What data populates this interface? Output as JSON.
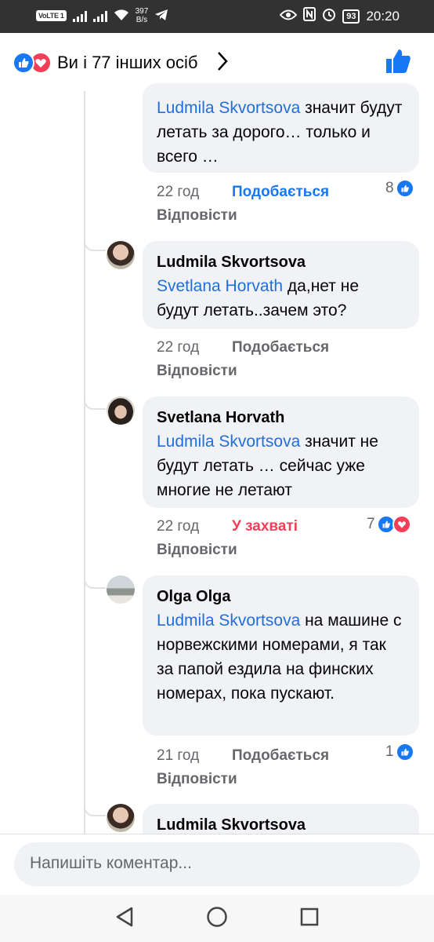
{
  "status_bar": {
    "volte": "VoLTE 1",
    "speed_top": "397",
    "speed_bottom": "B/s",
    "battery": "93",
    "time": "20:20"
  },
  "header": {
    "reaction_summary": "Ви і 77 інших осіб"
  },
  "comments": [
    {
      "author": "",
      "mention": "Ludmila Skvortsova",
      "text": "  значит будут летать за дорого… только и всего …",
      "time": "22 год",
      "like_label": "Подобається",
      "like_state": "liked",
      "reply_label": "Відповісти",
      "reaction_count": "8"
    },
    {
      "author": "Ludmila Skvortsova",
      "mention": "Svetlana Horvath",
      "text": " да,нет не будут летать..зачем это?",
      "time": "22 год",
      "like_label": "Подобається",
      "like_state": "none",
      "reply_label": "Відповісти",
      "reaction_count": ""
    },
    {
      "author": "Svetlana Horvath",
      "mention": "Ludmila Skvortsova",
      "text": "  значит не будут летать … сейчас уже многие не летают",
      "time": "22 год",
      "like_label": "У захваті",
      "like_state": "love",
      "reply_label": "Відповісти",
      "reaction_count": "7"
    },
    {
      "author": "Olga Olga",
      "mention": "Ludmila Skvortsova",
      "text": " на машине с норвежскими номерами, я так за папой ездила на финских номерах, пока пускают.",
      "time": "21 год",
      "like_label": "Подобається",
      "like_state": "none",
      "reply_label": "Відповісти",
      "reaction_count": "1"
    },
    {
      "author": "Ludmila Skvortsova"
    }
  ],
  "composer": {
    "placeholder": "Напишіть коментар..."
  },
  "colors": {
    "accent": "#1877f2",
    "love": "#f33e58",
    "mention": "#216fdb",
    "bubble": "#f0f2f5",
    "muted": "#65676b"
  }
}
